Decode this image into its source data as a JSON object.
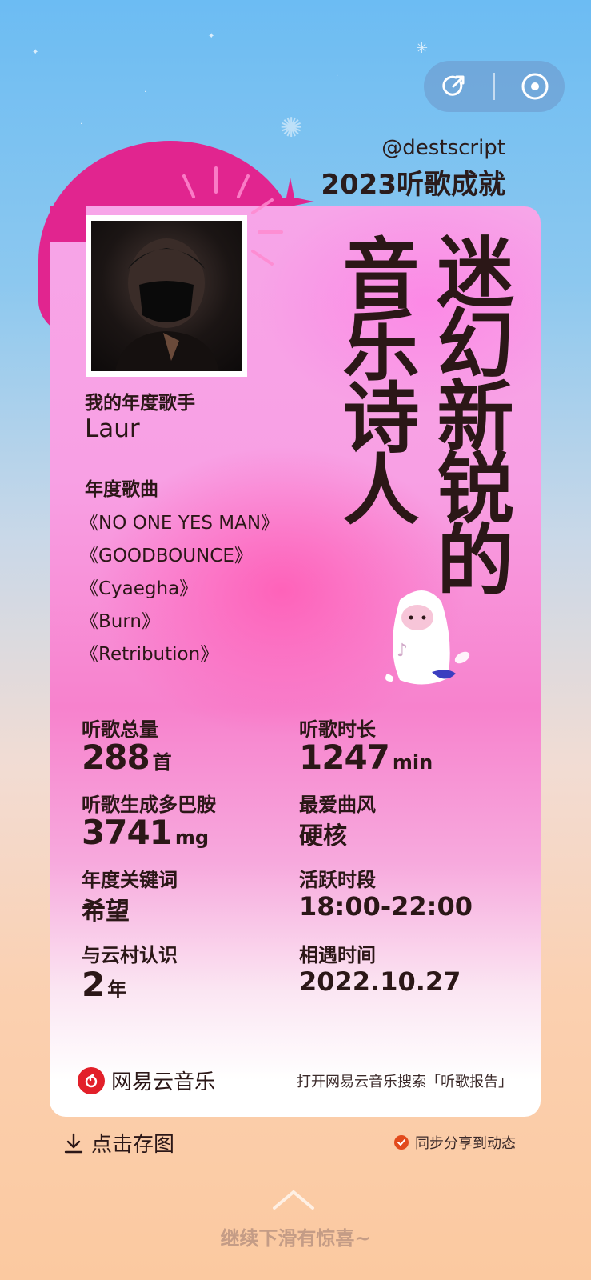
{
  "header": {
    "user_handle": "@destscript",
    "report_title": "2023听歌成就",
    "share_icon": "share-icon",
    "record_icon": "record-icon"
  },
  "title_lines": [
    "音乐诗人",
    "迷幻新锐的"
  ],
  "artist": {
    "label": "我的年度歌手",
    "name": "Laur"
  },
  "songs": {
    "label": "年度歌曲",
    "items": [
      "《NO ONE YES MAN》",
      "《GOODBOUNCE》",
      "《Cyaegha》",
      "《Burn》",
      "《Retribution》"
    ]
  },
  "stats": {
    "total_songs": {
      "label": "听歌总量",
      "value": "288",
      "unit": "首"
    },
    "duration": {
      "label": "听歌时长",
      "value": "1247",
      "unit": "min"
    },
    "dopamine": {
      "label": "听歌生成多巴胺",
      "value": "3741",
      "unit": "mg"
    },
    "favorite_style": {
      "label": "最爱曲风",
      "value": "硬核"
    },
    "keyword": {
      "label": "年度关键词",
      "value": "希望"
    },
    "active_time": {
      "label": "活跃时段",
      "value": "18:00-22:00"
    },
    "known_years": {
      "label": "与云村认识",
      "value": "2",
      "unit": "年"
    },
    "met_date": {
      "label": "相遇时间",
      "value": "2022.10.27"
    }
  },
  "footer": {
    "brand_name": "网易云音乐",
    "search_hint": "打开网易云音乐搜索「听歌报告」",
    "save_label": "点击存图",
    "sync_label": "同步分享到动态",
    "swipe_hint": "继续下滑有惊喜~"
  },
  "colors": {
    "accent_pink": "#e1258f",
    "brand_red": "#e2202a",
    "check_orange": "#e24a1c"
  }
}
